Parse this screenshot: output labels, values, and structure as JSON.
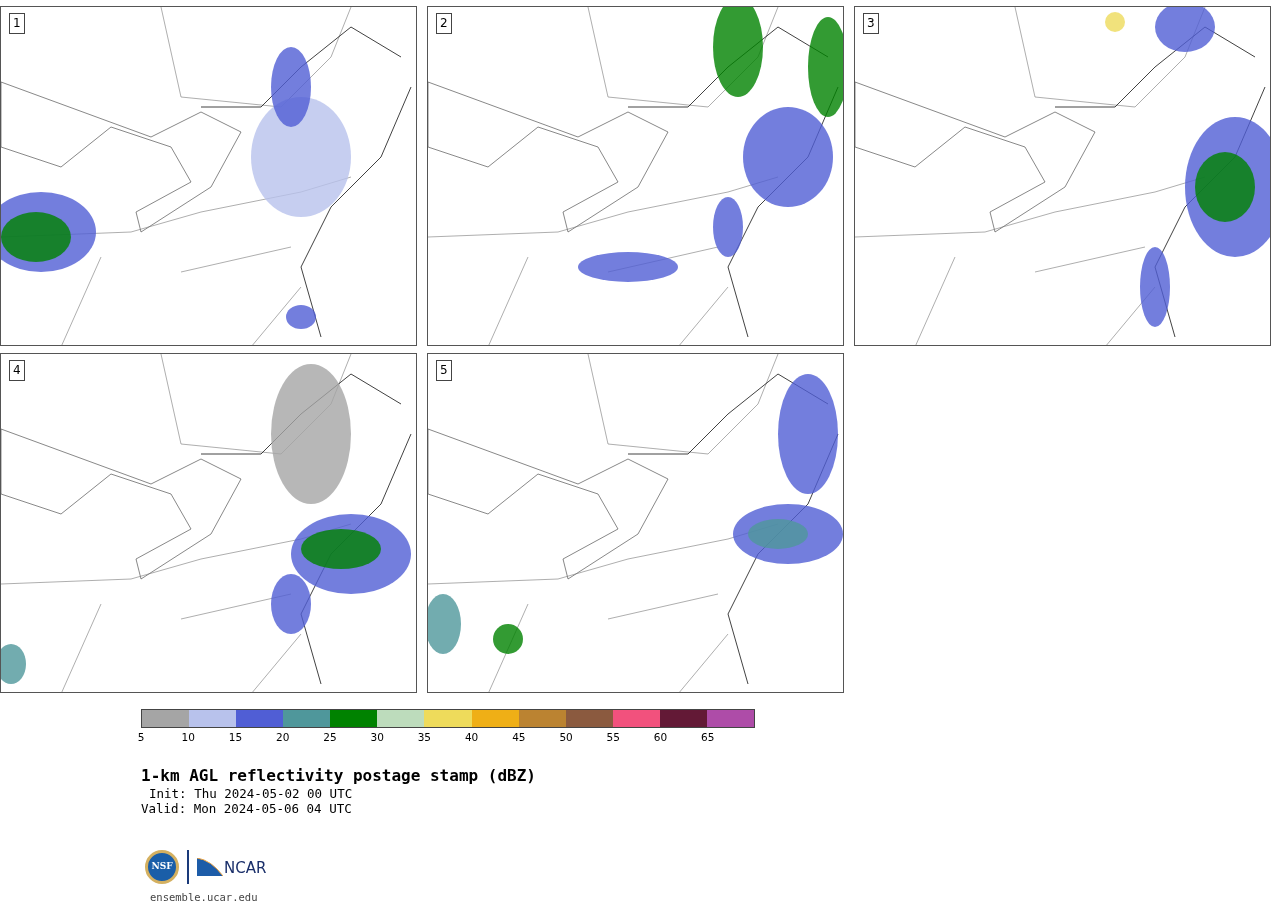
{
  "panels": [
    {
      "label": "1"
    },
    {
      "label": "2"
    },
    {
      "label": "3"
    },
    {
      "label": "4"
    },
    {
      "label": "5"
    }
  ],
  "colorbar": [
    {
      "color": "#a5a5a5",
      "label": "5"
    },
    {
      "color": "#b8c2ec",
      "label": "10"
    },
    {
      "color": "#505ed5",
      "label": "15"
    },
    {
      "color": "#4f979b",
      "label": "20"
    },
    {
      "color": "#008200",
      "label": "25"
    },
    {
      "color": "#bddcbc",
      "label": "30"
    },
    {
      "color": "#eedb5b",
      "label": "35"
    },
    {
      "color": "#efaf16",
      "label": "40"
    },
    {
      "color": "#bb8331",
      "label": "45"
    },
    {
      "color": "#8b5a3f",
      "label": "50"
    },
    {
      "color": "#f2517d",
      "label": "55"
    },
    {
      "color": "#631936",
      "label": "60"
    },
    {
      "color": "#ae4ca8",
      "label": "65"
    }
  ],
  "title": "1-km AGL reflectivity postage stamp (dBZ)",
  "init": "Init: Thu 2024-05-02 00 UTC",
  "valid": "Valid: Mon 2024-05-06 04 UTC",
  "logos": {
    "nsf": "NSF",
    "ncar": "NCAR"
  },
  "url": "ensemble.ucar.edu"
}
